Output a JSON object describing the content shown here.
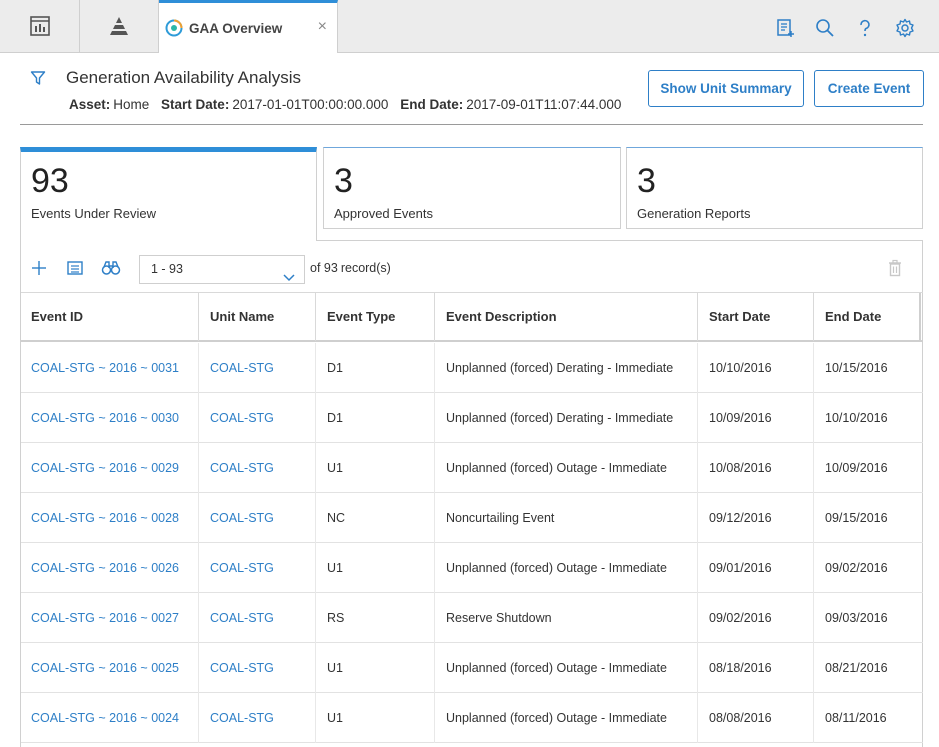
{
  "tabs": {
    "active_label": "GAA Overview",
    "close_glyph": "×"
  },
  "colors": {
    "accent": "#2e8ed8",
    "link": "#2e7fc7"
  },
  "header": {
    "title": "Generation Availability Analysis",
    "asset_label": "Asset:",
    "asset_value": "Home",
    "start_label": "Start Date:",
    "start_value": "2017-01-01T00:00:00.000",
    "end_label": "End Date:",
    "end_value": "2017-09-01T11:07:44.000",
    "show_unit_summary": "Show Unit Summary",
    "create_event": "Create Event"
  },
  "cards": [
    {
      "count": "93",
      "caption": "Events Under Review"
    },
    {
      "count": "3",
      "caption": "Approved Events"
    },
    {
      "count": "3",
      "caption": "Generation Reports"
    }
  ],
  "toolbar": {
    "pager_value": "1 - 93",
    "records_prefix": "of",
    "records_count": "93",
    "records_suffix": "record(s)"
  },
  "table": {
    "columns": [
      "Event ID",
      "Unit Name",
      "Event Type",
      "Event Description",
      "Start Date",
      "End Date"
    ],
    "rows": [
      [
        "COAL-STG ~ 2016 ~ 0031",
        "COAL-STG",
        "D1",
        "Unplanned (forced) Derating - Immediate",
        "10/10/2016",
        "10/15/2016"
      ],
      [
        "COAL-STG ~ 2016 ~ 0030",
        "COAL-STG",
        "D1",
        "Unplanned (forced) Derating - Immediate",
        "10/09/2016",
        "10/10/2016"
      ],
      [
        "COAL-STG ~ 2016 ~ 0029",
        "COAL-STG",
        "U1",
        "Unplanned (forced) Outage - Immediate",
        "10/08/2016",
        "10/09/2016"
      ],
      [
        "COAL-STG ~ 2016 ~ 0028",
        "COAL-STG",
        "NC",
        "Noncurtailing Event",
        "09/12/2016",
        "09/15/2016"
      ],
      [
        "COAL-STG ~ 2016 ~ 0026",
        "COAL-STG",
        "U1",
        "Unplanned (forced) Outage - Immediate",
        "09/01/2016",
        "09/02/2016"
      ],
      [
        "COAL-STG ~ 2016 ~ 0027",
        "COAL-STG",
        "RS",
        "Reserve Shutdown",
        "09/02/2016",
        "09/03/2016"
      ],
      [
        "COAL-STG ~ 2016 ~ 0025",
        "COAL-STG",
        "U1",
        "Unplanned (forced) Outage - Immediate",
        "08/18/2016",
        "08/21/2016"
      ],
      [
        "COAL-STG ~ 2016 ~ 0024",
        "COAL-STG",
        "U1",
        "Unplanned (forced) Outage - Immediate",
        "08/08/2016",
        "08/11/2016"
      ]
    ]
  }
}
